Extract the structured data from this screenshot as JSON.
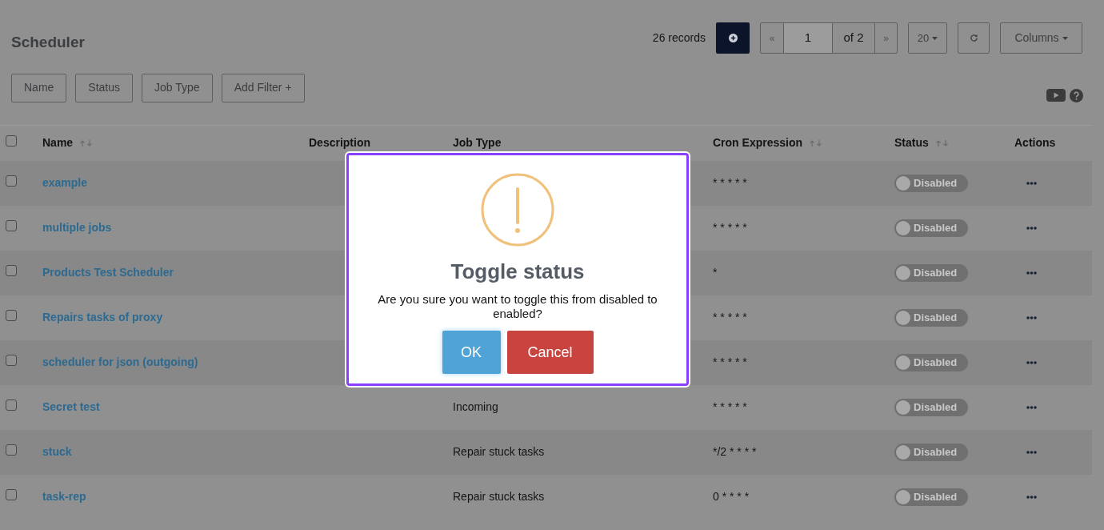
{
  "title": "Scheduler",
  "toolbar": {
    "records": "26 records",
    "pager": {
      "prev": "«",
      "page": "1",
      "of": "of 2",
      "next": "»"
    },
    "page_size": "20",
    "columns": "Columns"
  },
  "filters": [
    "Name",
    "Status",
    "Job Type",
    "Add Filter +"
  ],
  "table": {
    "select_all": {
      "checked": false
    },
    "columns": [
      {
        "label": "Name",
        "sortable": true
      },
      {
        "label": "Description",
        "sortable": false
      },
      {
        "label": "Job Type",
        "sortable": false
      },
      {
        "label": "Cron Expression",
        "sortable": true
      },
      {
        "label": "Status",
        "sortable": true
      },
      {
        "label": "Actions",
        "sortable": false
      }
    ],
    "rows": [
      {
        "checked": false,
        "name": "example",
        "cron": "* * * * *",
        "status": {
          "label": "Disabled",
          "on": false
        }
      },
      {
        "checked": false,
        "name": "multiple jobs",
        "cron": "* * * * *",
        "status": {
          "label": "Disabled",
          "on": false
        }
      },
      {
        "checked": false,
        "name": "Products Test Scheduler",
        "cron": "*",
        "status": {
          "label": "Disabled",
          "on": false
        }
      },
      {
        "checked": false,
        "name": "Repairs tasks of proxy",
        "cron": "* * * * *",
        "status": {
          "label": "Disabled",
          "on": false
        }
      },
      {
        "checked": false,
        "name": "scheduler for json (outgoing)",
        "cron": "* * * * *",
        "status": {
          "label": "Disabled",
          "on": false
        }
      },
      {
        "checked": false,
        "name": "Secret test",
        "job_type": "Incoming",
        "cron": "* * * * *",
        "status": {
          "label": "Disabled",
          "on": false
        }
      },
      {
        "checked": false,
        "name": "stuck",
        "job_type": "Repair stuck tasks",
        "cron": "*/2 * * * *",
        "status": {
          "label": "Disabled",
          "on": false
        }
      },
      {
        "checked": false,
        "name": "task-rep",
        "job_type": "Repair stuck tasks",
        "cron": "0 * * * *",
        "status": {
          "label": "Disabled",
          "on": false
        }
      }
    ]
  },
  "dialog": {
    "title": "Toggle status",
    "message": "Are you sure you want to toggle this from disabled to enabled?",
    "buttons": [
      {
        "label": "OK",
        "kind": "confirm"
      },
      {
        "label": "Cancel",
        "kind": "cancel"
      }
    ]
  }
}
